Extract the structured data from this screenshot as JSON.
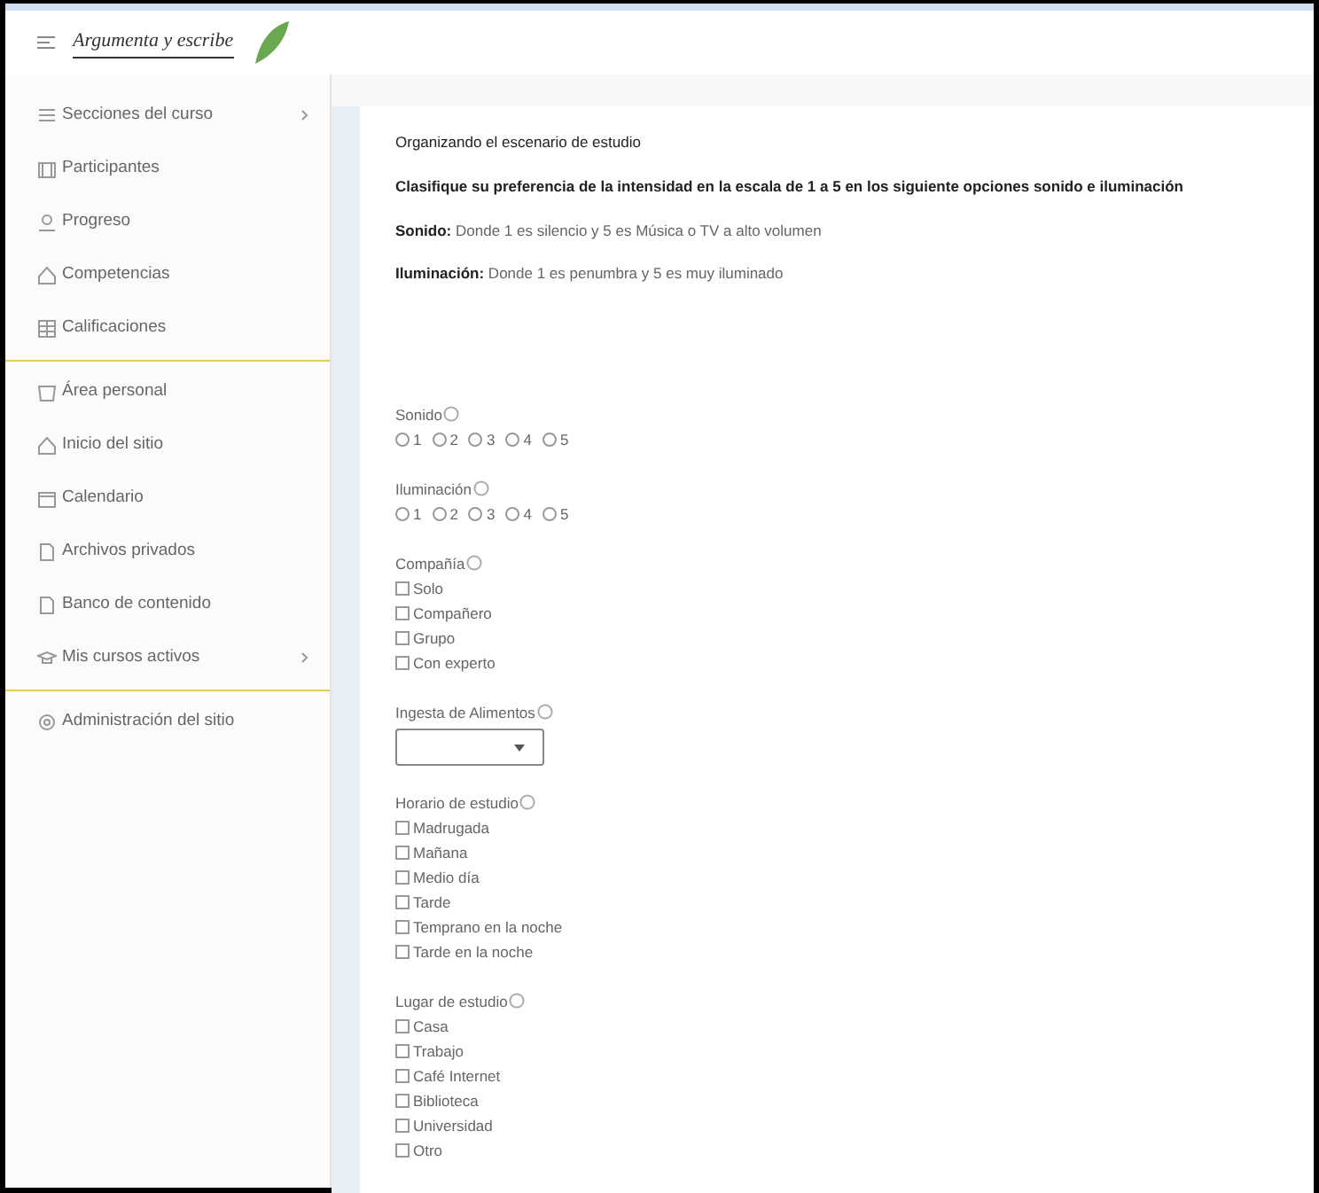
{
  "header": {
    "logo_text": "Argumenta y escribe"
  },
  "sidebar": {
    "items": [
      {
        "label": "Secciones del curso",
        "has_submenu": true,
        "divider_after": false
      },
      {
        "label": "Participantes",
        "has_submenu": false,
        "divider_after": false
      },
      {
        "label": "Progreso",
        "has_submenu": false,
        "divider_after": false
      },
      {
        "label": "Competencias",
        "has_submenu": false,
        "divider_after": false
      },
      {
        "label": "Calificaciones",
        "has_submenu": false,
        "divider_after": true
      },
      {
        "label": "Área personal",
        "has_submenu": false,
        "divider_after": false
      },
      {
        "label": "Inicio del sitio",
        "has_submenu": false,
        "divider_after": false
      },
      {
        "label": "Calendario",
        "has_submenu": false,
        "divider_after": false
      },
      {
        "label": "Archivos privados",
        "has_submenu": false,
        "divider_after": false
      },
      {
        "label": "Banco de contenido",
        "has_submenu": false,
        "divider_after": false
      },
      {
        "label": "Mis cursos activos",
        "has_submenu": true,
        "divider_after": true
      },
      {
        "label": "Administración del sitio",
        "has_submenu": false,
        "divider_after": false
      }
    ]
  },
  "intro": {
    "title": "Organizando el escenario de estudio",
    "instruction": "Clasifique su preferencia de la intensidad en la escala de 1 a 5 en los siguiente opciones sonido e iluminación",
    "notes": [
      "**Sonido:** Donde 1 es silencio y 5 es Música o TV a alto volumen",
      "**Iluminación:** Donde 1 es penumbra y 5 es muy iluminado"
    ]
  },
  "questions": [
    {
      "label": "Sonido",
      "kind": "radio",
      "options": [
        {
          "label": "1",
          "checked": false
        },
        {
          "label": "2",
          "checked": false
        },
        {
          "label": "3",
          "checked": false
        },
        {
          "label": "4",
          "checked": false
        },
        {
          "label": "5",
          "checked": false
        }
      ]
    },
    {
      "label": "Iluminación",
      "kind": "radio",
      "options": [
        {
          "label": "1",
          "checked": false
        },
        {
          "label": "2",
          "checked": false
        },
        {
          "label": "3",
          "checked": false
        },
        {
          "label": "4",
          "checked": false
        },
        {
          "label": "5",
          "checked": false
        }
      ]
    },
    {
      "label": "Compañía",
      "kind": "checkbox",
      "options": [
        {
          "label": "Solo",
          "checked": false
        },
        {
          "label": "Compañero",
          "checked": false
        },
        {
          "label": "Grupo",
          "checked": false
        },
        {
          "label": "Con experto",
          "checked": false
        }
      ]
    },
    {
      "label": "Ingesta de Alimentos",
      "kind": "select"
    },
    {
      "label": "Horario de estudio",
      "kind": "checkbox",
      "options": [
        {
          "label": "Madrugada",
          "checked": false
        },
        {
          "label": "Mañana",
          "checked": false
        },
        {
          "label": "Medio día",
          "checked": false
        },
        {
          "label": "Tarde",
          "checked": false
        },
        {
          "label": "Temprano en la noche",
          "checked": false
        },
        {
          "label": "Tarde en la noche",
          "checked": false
        }
      ]
    },
    {
      "label": "Lugar de estudio",
      "kind": "checkbox",
      "options": [
        {
          "label": "Casa",
          "checked": false
        },
        {
          "label": "Trabajo",
          "checked": false
        },
        {
          "label": "Café Internet",
          "checked": false
        },
        {
          "label": "Biblioteca",
          "checked": false
        },
        {
          "label": "Universidad",
          "checked": false
        },
        {
          "label": "Otro",
          "checked": false
        }
      ]
    }
  ]
}
